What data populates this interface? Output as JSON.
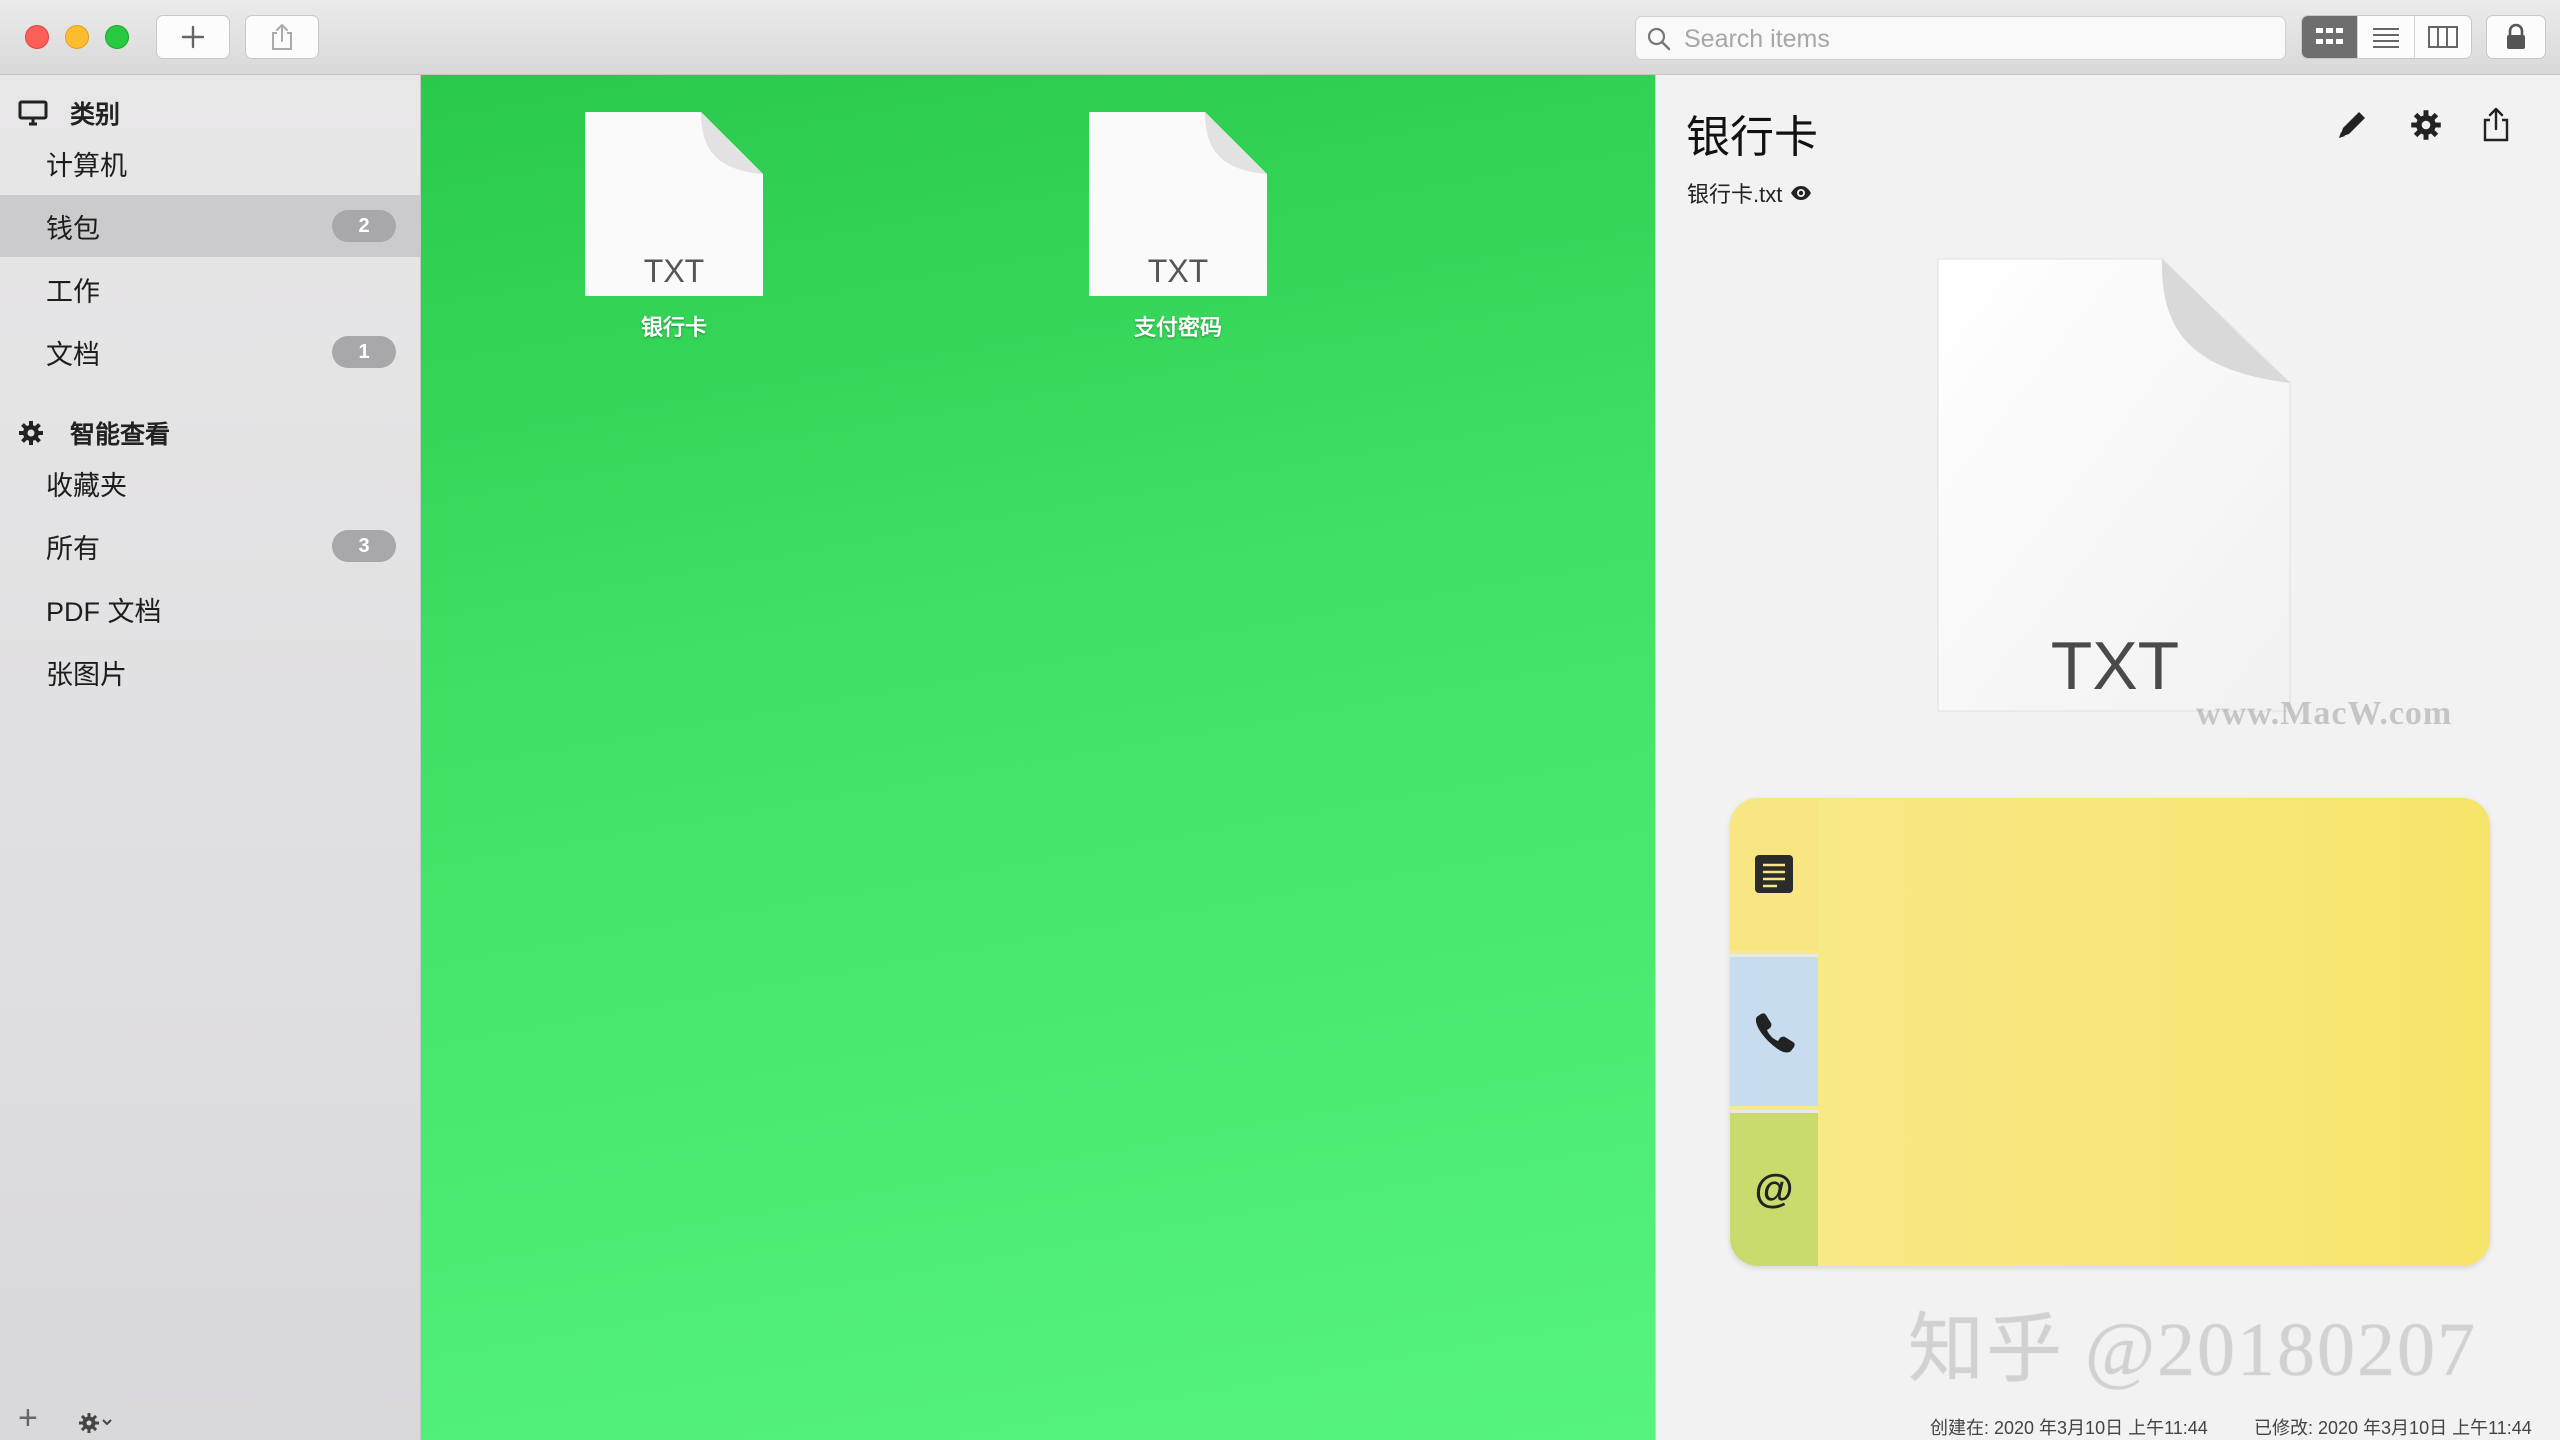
{
  "toolbar": {
    "search_placeholder": "Search items"
  },
  "sidebar": {
    "categories_header": "类别",
    "categories": [
      {
        "label": "计算机",
        "count": null
      },
      {
        "label": "钱包",
        "count": "2",
        "selected": true
      },
      {
        "label": "工作",
        "count": null
      },
      {
        "label": "文档",
        "count": "1"
      }
    ],
    "smart_header": "智能查看",
    "smart": [
      {
        "label": "收藏夹",
        "count": null
      },
      {
        "label": "所有",
        "count": "3"
      },
      {
        "label": "PDF 文档",
        "count": null
      },
      {
        "label": "张图片",
        "count": null
      }
    ]
  },
  "main": {
    "files": [
      {
        "name": "银行卡",
        "type": "TXT"
      },
      {
        "name": "支付密码",
        "type": "TXT"
      }
    ]
  },
  "detail": {
    "title": "银行卡",
    "filename": "银行卡.txt",
    "preview_type": "TXT",
    "watermark_site": "www.MacW.com",
    "watermark_credit": "知乎 @20180207",
    "email_symbol": "@",
    "created": "创建在: 2020 年3月10日 上午11:44",
    "modified": "已修改: 2020 年3月10日 上午11:44"
  },
  "colors": {
    "main_green_top": "#2ac94b",
    "main_green_bottom": "#56f47e",
    "card_yellow": "#f7e46a",
    "card_blue": "#c7dcee",
    "card_lime": "#c9db6d",
    "badge": "#a8a8ab"
  },
  "icons": [
    "plus-icon",
    "share-icon",
    "search-icon",
    "grid-view-icon",
    "list-view-icon",
    "column-view-icon",
    "lock-icon",
    "monitor-icon",
    "gear-icon",
    "pencil-icon",
    "settings-gear-icon",
    "export-icon",
    "eye-icon",
    "notes-icon",
    "phone-icon",
    "at-icon"
  ]
}
